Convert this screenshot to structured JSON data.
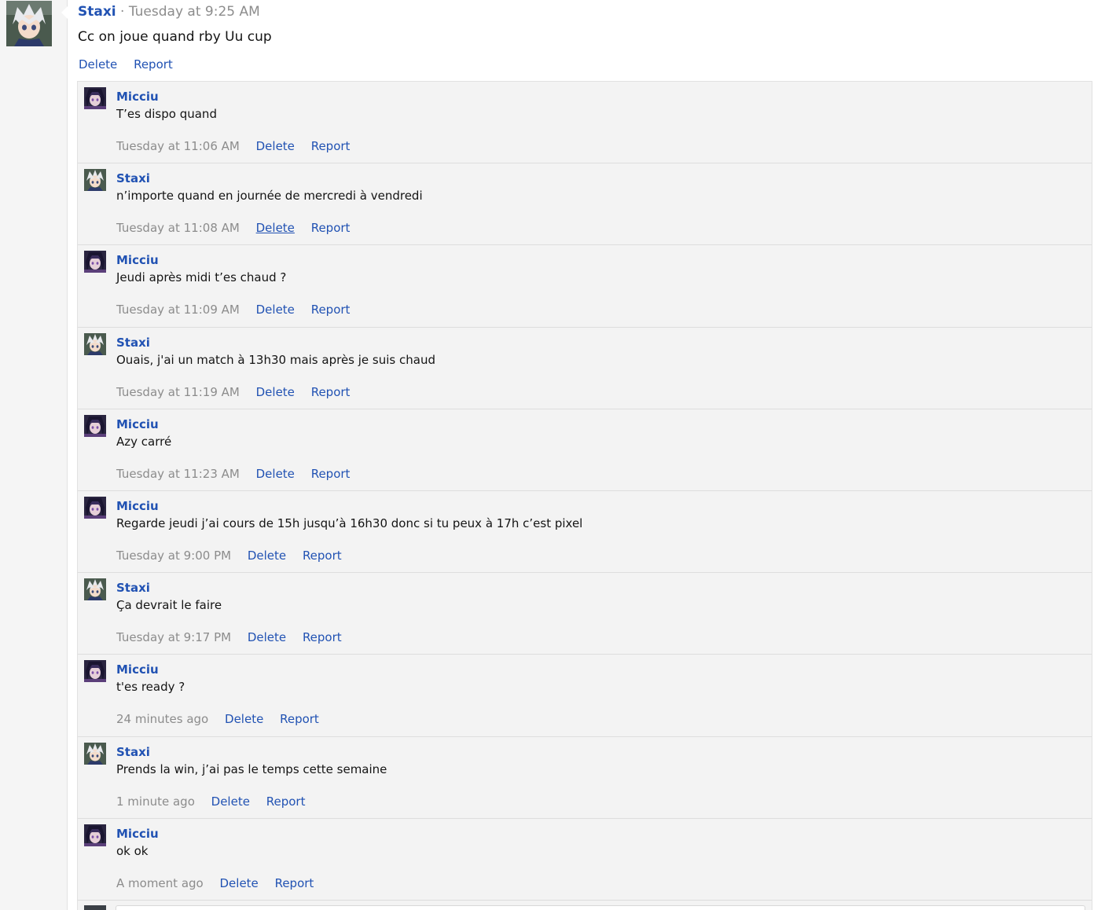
{
  "status": {
    "poster": "Staxi",
    "separator": "·",
    "time": "Tuesday at 9:25 AM",
    "text": "Cc on joue quand rby Uu cup",
    "delete_label": "Delete",
    "report_label": "Report"
  },
  "comments": [
    {
      "author": "Micciu",
      "avatar": "micciu-avatar",
      "text": "T’es dispo quand",
      "time": "Tuesday at 11:06 AM",
      "delete": "Delete",
      "report": "Report"
    },
    {
      "author": "Staxi",
      "avatar": "staxi-avatar",
      "text": "n’importe quand en journée de mercredi à vendredi",
      "time": "Tuesday at 11:08 AM",
      "delete": "Delete",
      "report": "Report"
    },
    {
      "author": "Micciu",
      "avatar": "micciu-avatar",
      "text": "Jeudi après midi t’es chaud ?",
      "time": "Tuesday at 11:09 AM",
      "delete": "Delete",
      "report": "Report"
    },
    {
      "author": "Staxi",
      "avatar": "staxi-avatar",
      "text": "Ouais, j'ai un match à 13h30 mais après je suis chaud",
      "time": "Tuesday at 11:19 AM",
      "delete": "Delete",
      "report": "Report"
    },
    {
      "author": "Micciu",
      "avatar": "micciu-avatar",
      "text": "Azy carré",
      "time": "Tuesday at 11:23 AM",
      "delete": "Delete",
      "report": "Report"
    },
    {
      "author": "Micciu",
      "avatar": "micciu-avatar",
      "text": "Regarde jeudi j’ai cours de 15h jusqu’à 16h30 donc si tu peux à 17h c’est pixel",
      "time": "Tuesday at 9:00 PM",
      "delete": "Delete",
      "report": "Report"
    },
    {
      "author": "Staxi",
      "avatar": "staxi-avatar",
      "text": "Ça devrait le faire",
      "time": "Tuesday at 9:17 PM",
      "delete": "Delete",
      "report": "Report"
    },
    {
      "author": "Micciu",
      "avatar": "micciu-avatar",
      "text": "t'es ready ?",
      "time": "24 minutes ago",
      "delete": "Delete",
      "report": "Report"
    },
    {
      "author": "Staxi",
      "avatar": "staxi-avatar",
      "text": "Prends la win, j’ai pas le temps cette semaine",
      "time": "1 minute ago",
      "delete": "Delete",
      "report": "Report"
    },
    {
      "author": "Micciu",
      "avatar": "micciu-avatar",
      "text": "ok ok",
      "time": "A moment ago",
      "delete": "Delete",
      "report": "Report"
    }
  ],
  "colors": {
    "link": "#2152b3",
    "muted": "#8c8c8c",
    "comment_bg": "#f3f3f3"
  }
}
